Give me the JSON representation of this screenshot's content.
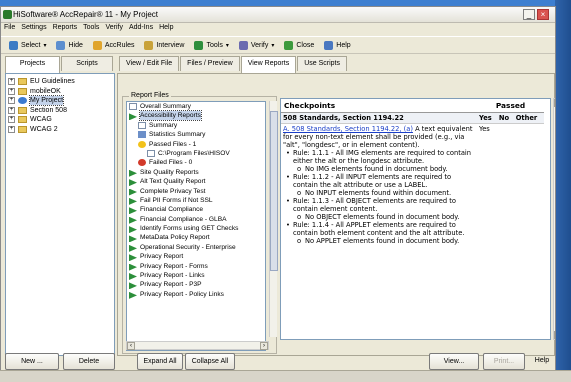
{
  "window": {
    "title": "HiSoftware® AccRepair® 11 - My Project",
    "min_glyph": "_",
    "close_glyph": "×"
  },
  "menu": [
    "File",
    "Settings",
    "Reports",
    "Tools",
    "Verify",
    "Add-Ins",
    "Help"
  ],
  "toolbar": [
    {
      "label": "Select",
      "icon": "select-icon",
      "caret": true,
      "color": "#3b7bc4"
    },
    {
      "label": "Hide",
      "icon": "hide-icon",
      "caret": false,
      "color": "#5d8fcf"
    },
    {
      "label": "AccRules",
      "icon": "rules-icon",
      "caret": false,
      "color": "#e0a52d"
    },
    {
      "label": "Interview",
      "icon": "wand-icon",
      "caret": false,
      "color": "#c9a33a"
    },
    {
      "label": "Tools",
      "icon": "tools-icon",
      "caret": true,
      "color": "#2f8f3d"
    },
    {
      "label": "Verify",
      "icon": "pencil-icon",
      "caret": true,
      "color": "#6b6bb0"
    },
    {
      "label": "Close",
      "icon": "close-doc-icon",
      "caret": false,
      "color": "#3d9a3d"
    },
    {
      "label": "Help",
      "icon": "help-icon",
      "caret": false,
      "color": "#4a78c0"
    }
  ],
  "left_tabs": [
    "Projects",
    "Scripts"
  ],
  "projects": [
    {
      "label": "EU Guidelines",
      "icon": "folder"
    },
    {
      "label": "mobileOK",
      "icon": "folder"
    },
    {
      "label": "My Project",
      "icon": "globe",
      "selected": true
    },
    {
      "label": "Section 508",
      "icon": "folder"
    },
    {
      "label": "WCAG",
      "icon": "folder"
    },
    {
      "label": "WCAG 2",
      "icon": "folder"
    }
  ],
  "main_tabs": [
    {
      "label": "View / Edit File",
      "active": false
    },
    {
      "label": "Files / Preview",
      "active": false
    },
    {
      "label": "View Reports",
      "active": true
    },
    {
      "label": "Use Scripts",
      "active": false
    }
  ],
  "report_files_label": "Report Files",
  "report_tree": [
    {
      "label": "Overall Summary",
      "indent": 1,
      "icon": "page"
    },
    {
      "label": "Accessibility Reports",
      "indent": 1,
      "icon": "leaf",
      "selected": true
    },
    {
      "label": "Summary",
      "indent": 2,
      "icon": "page"
    },
    {
      "label": "Statistics Summary",
      "indent": 2,
      "icon": "chart"
    },
    {
      "label": "Passed Files - 1",
      "indent": 2,
      "icon": "smile"
    },
    {
      "label": "C:\\Program Files\\HISOV",
      "indent": 3,
      "icon": "page"
    },
    {
      "label": "Failed Files - 0",
      "indent": 2,
      "icon": "frown"
    },
    {
      "label": "Site Quality Reports",
      "indent": 1,
      "icon": "leaf"
    },
    {
      "label": "Alt Text Quality Report",
      "indent": 1,
      "icon": "leaf"
    },
    {
      "label": "Complete Privacy Test",
      "indent": 1,
      "icon": "leaf"
    },
    {
      "label": "Fail PII Forms if Not SSL",
      "indent": 1,
      "icon": "leaf"
    },
    {
      "label": "Financial Compliance",
      "indent": 1,
      "icon": "leaf"
    },
    {
      "label": "Financial Compliance - GLBA",
      "indent": 1,
      "icon": "leaf"
    },
    {
      "label": "Identify Forms using GET Checks",
      "indent": 1,
      "icon": "leaf"
    },
    {
      "label": "MetaData Policy Report",
      "indent": 1,
      "icon": "leaf"
    },
    {
      "label": "Operational Security - Enterprise",
      "indent": 1,
      "icon": "leaf"
    },
    {
      "label": "Privacy Report",
      "indent": 1,
      "icon": "leaf"
    },
    {
      "label": "Privacy Report - Forms",
      "indent": 1,
      "icon": "leaf"
    },
    {
      "label": "Privacy Report - Links",
      "indent": 1,
      "icon": "leaf"
    },
    {
      "label": "Privacy Report - P3P",
      "indent": 1,
      "icon": "leaf"
    },
    {
      "label": "Privacy Report - Policy Links",
      "indent": 1,
      "icon": "leaf"
    }
  ],
  "report": {
    "col_checkpoints": "Checkpoints",
    "col_passed": "Passed",
    "col_yes": "Yes",
    "col_no": "No",
    "col_other": "Other",
    "section": "508 Standards, Section 1194.22",
    "checkpoint_link": "A. 508 Standards, Section 1194.22, (a)",
    "checkpoint_text": "A text equivalent for every non-text element shall be provided (e.g., via \"alt\", \"longdesc\", or in element content).",
    "passed_yes": "Yes",
    "rules": [
      {
        "rule": "Rule: 1.1.1 - All IMG elements are required to contain either the alt or the longdesc attribute.",
        "sub": "No IMG elements found in document body."
      },
      {
        "rule": "Rule: 1.1.2 - All INPUT elements are required to contain the alt attribute or use a LABEL.",
        "sub": "No INPUT elements found within document."
      },
      {
        "rule": "Rule: 1.1.3 - All OBJECT elements are required to contain element content.",
        "sub": "No OBJECT elements found in document body."
      },
      {
        "rule": "Rule: 1.1.4 - All APPLET elements are required to contain both element content and the alt attribute.",
        "sub": "No APPLET elements found in document body."
      }
    ]
  },
  "buttons": {
    "new": "New ...",
    "delete": "Delete",
    "expand_all": "Expand All",
    "collapse_all": "Collapse All",
    "view": "View...",
    "print": "Print...",
    "help": "Help"
  }
}
